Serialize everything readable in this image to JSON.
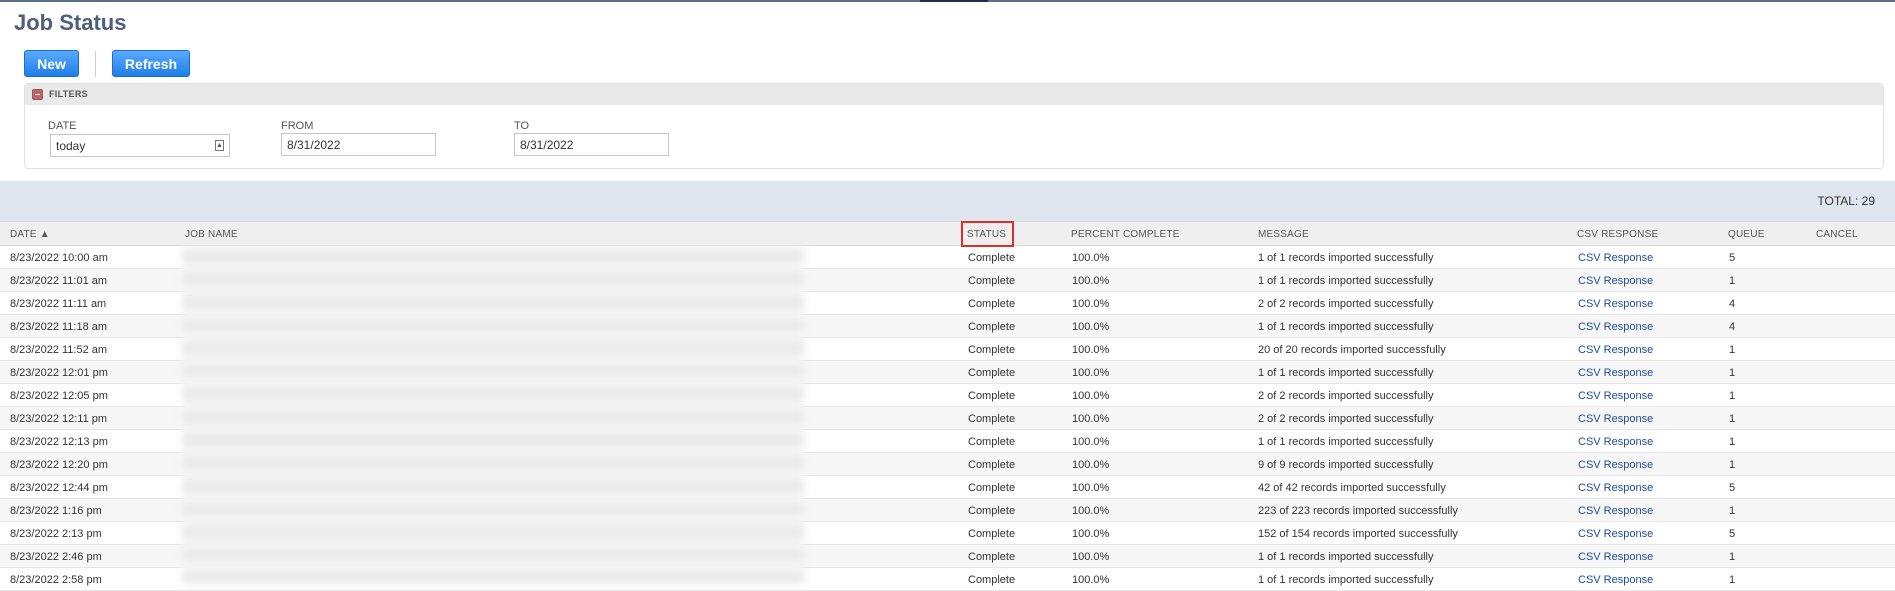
{
  "page": {
    "title": "Job Status"
  },
  "toolbar": {
    "new_label": "New",
    "refresh_label": "Refresh"
  },
  "filters": {
    "title": "FILTERS",
    "date": {
      "label": "DATE",
      "value": "today"
    },
    "from": {
      "label": "FROM",
      "value": "8/31/2022"
    },
    "to": {
      "label": "TO",
      "value": "8/31/2022"
    }
  },
  "summary": {
    "total": "TOTAL: 29"
  },
  "table": {
    "columns": {
      "date": "DATE ▲",
      "job_name": "JOB NAME",
      "status": "STATUS",
      "percent": "PERCENT COMPLETE",
      "message": "MESSAGE",
      "csv": "CSV RESPONSE",
      "queue": "QUEUE",
      "cancel": "CANCEL"
    },
    "rows": [
      {
        "date": "8/23/2022 10:00 am",
        "status": "Complete",
        "percent": "100.0%",
        "message": "1 of 1 records imported successfully",
        "csv": "CSV Response",
        "queue": "5"
      },
      {
        "date": "8/23/2022 11:01 am",
        "status": "Complete",
        "percent": "100.0%",
        "message": "1 of 1 records imported successfully",
        "csv": "CSV Response",
        "queue": "1"
      },
      {
        "date": "8/23/2022 11:11 am",
        "status": "Complete",
        "percent": "100.0%",
        "message": "2 of 2 records imported successfully",
        "csv": "CSV Response",
        "queue": "4"
      },
      {
        "date": "8/23/2022 11:18 am",
        "status": "Complete",
        "percent": "100.0%",
        "message": "1 of 1 records imported successfully",
        "csv": "CSV Response",
        "queue": "4"
      },
      {
        "date": "8/23/2022 11:52 am",
        "status": "Complete",
        "percent": "100.0%",
        "message": "20 of 20 records imported successfully",
        "csv": "CSV Response",
        "queue": "1"
      },
      {
        "date": "8/23/2022 12:01 pm",
        "status": "Complete",
        "percent": "100.0%",
        "message": "1 of 1 records imported successfully",
        "csv": "CSV Response",
        "queue": "1"
      },
      {
        "date": "8/23/2022 12:05 pm",
        "status": "Complete",
        "percent": "100.0%",
        "message": "2 of 2 records imported successfully",
        "csv": "CSV Response",
        "queue": "1"
      },
      {
        "date": "8/23/2022 12:11 pm",
        "status": "Complete",
        "percent": "100.0%",
        "message": "2 of 2 records imported successfully",
        "csv": "CSV Response",
        "queue": "1"
      },
      {
        "date": "8/23/2022 12:13 pm",
        "status": "Complete",
        "percent": "100.0%",
        "message": "1 of 1 records imported successfully",
        "csv": "CSV Response",
        "queue": "1"
      },
      {
        "date": "8/23/2022 12:20 pm",
        "status": "Complete",
        "percent": "100.0%",
        "message": "9 of 9 records imported successfully",
        "csv": "CSV Response",
        "queue": "1"
      },
      {
        "date": "8/23/2022 12:44 pm",
        "status": "Complete",
        "percent": "100.0%",
        "message": "42 of 42 records imported successfully",
        "csv": "CSV Response",
        "queue": "5"
      },
      {
        "date": "8/23/2022 1:16 pm",
        "status": "Complete",
        "percent": "100.0%",
        "message": "223 of 223 records imported successfully",
        "csv": "CSV Response",
        "queue": "1"
      },
      {
        "date": "8/23/2022 2:13 pm",
        "status": "Complete",
        "percent": "100.0%",
        "message": "152 of 154 records imported successfully",
        "csv": "CSV Response",
        "queue": "5"
      },
      {
        "date": "8/23/2022 2:46 pm",
        "status": "Complete",
        "percent": "100.0%",
        "message": "1 of 1 records imported successfully",
        "csv": "CSV Response",
        "queue": "1"
      },
      {
        "date": "8/23/2022 2:58 pm",
        "status": "Complete",
        "percent": "100.0%",
        "message": "1 of 1 records imported successfully",
        "csv": "CSV Response",
        "queue": "1"
      }
    ]
  },
  "icons": {
    "collapse": "collapse-minus-icon",
    "dropdown": "dropdown-caret-icon"
  },
  "colors": {
    "title": "#4d5f79",
    "button": "#1f7fe6",
    "link": "#1e4d9b",
    "highlight": "#d9302b",
    "band": "#e0e6ef"
  }
}
